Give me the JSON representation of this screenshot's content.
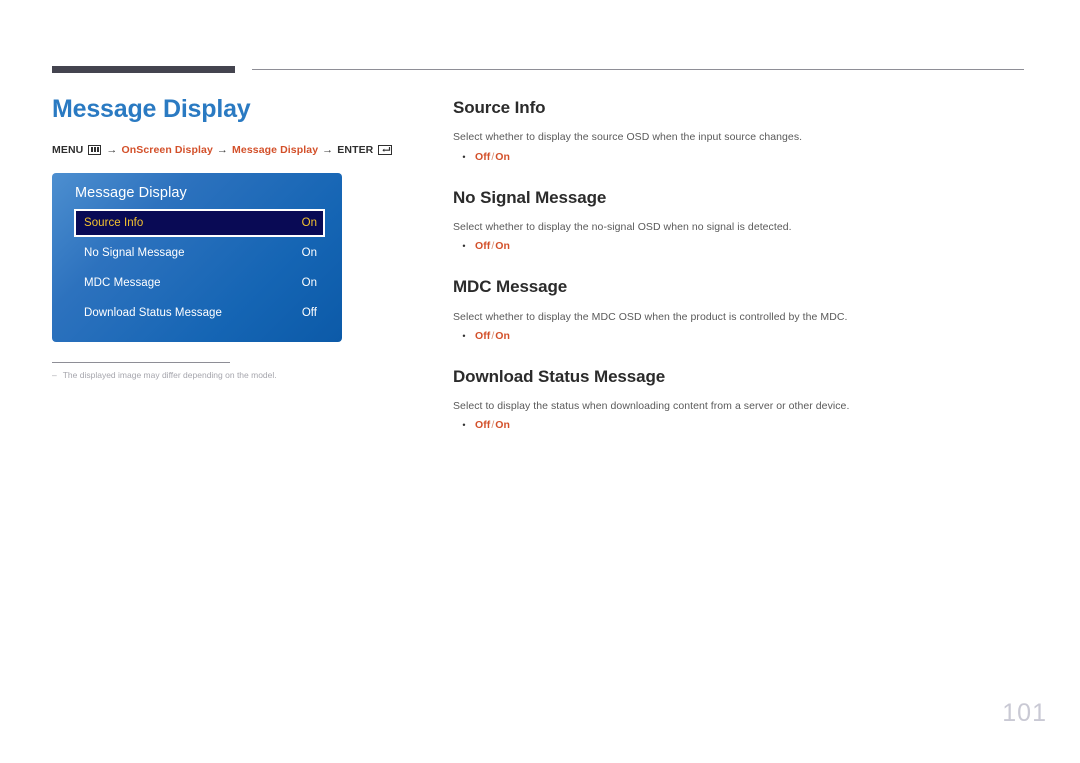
{
  "header": {
    "rule_color": "#44444f",
    "thin_rule_color": "#8e8e96"
  },
  "left": {
    "page_title": "Message Display",
    "title_color": "#2a7ac2",
    "breadcrumb": {
      "menu_label": "MENU",
      "menu_icon": "menu-grid-icon",
      "arrow": "→",
      "crumb_1": "OnScreen Display",
      "crumb_2": "Message Display",
      "enter_label": "ENTER",
      "enter_icon": "enter-key-icon",
      "accent_color": "#d3502a"
    },
    "osd": {
      "title": "Message Display",
      "rows": [
        {
          "label": "Source Info",
          "value": "On",
          "selected": true
        },
        {
          "label": "No Signal Message",
          "value": "On",
          "selected": false
        },
        {
          "label": "MDC Message",
          "value": "On",
          "selected": false
        },
        {
          "label": "Download Status Message",
          "value": "Off",
          "selected": false
        }
      ],
      "selected_text_color": "#f3c230",
      "selected_bg_color": "#090a55"
    },
    "note": {
      "dash": "–",
      "text": "The displayed image may differ depending on the model."
    }
  },
  "right": {
    "sections": [
      {
        "title": "Source Info",
        "description": "Select whether to display the source OSD when the input source changes.",
        "bullet": "•",
        "option_off": "Off",
        "option_sep": "/",
        "option_on": "On"
      },
      {
        "title": "No Signal Message",
        "description": "Select whether to display the no-signal OSD when no signal is detected.",
        "bullet": "•",
        "option_off": "Off",
        "option_sep": "/",
        "option_on": "On"
      },
      {
        "title": "MDC Message",
        "description": "Select whether to display the MDC OSD when the product is controlled by the MDC.",
        "bullet": "•",
        "option_off": "Off",
        "option_sep": "/",
        "option_on": "On"
      },
      {
        "title": "Download Status Message",
        "description": "Select to display the status when downloading content from a server or other device.",
        "bullet": "•",
        "option_off": "Off",
        "option_sep": "/",
        "option_on": "On"
      }
    ]
  },
  "footer": {
    "page_number": "101"
  }
}
